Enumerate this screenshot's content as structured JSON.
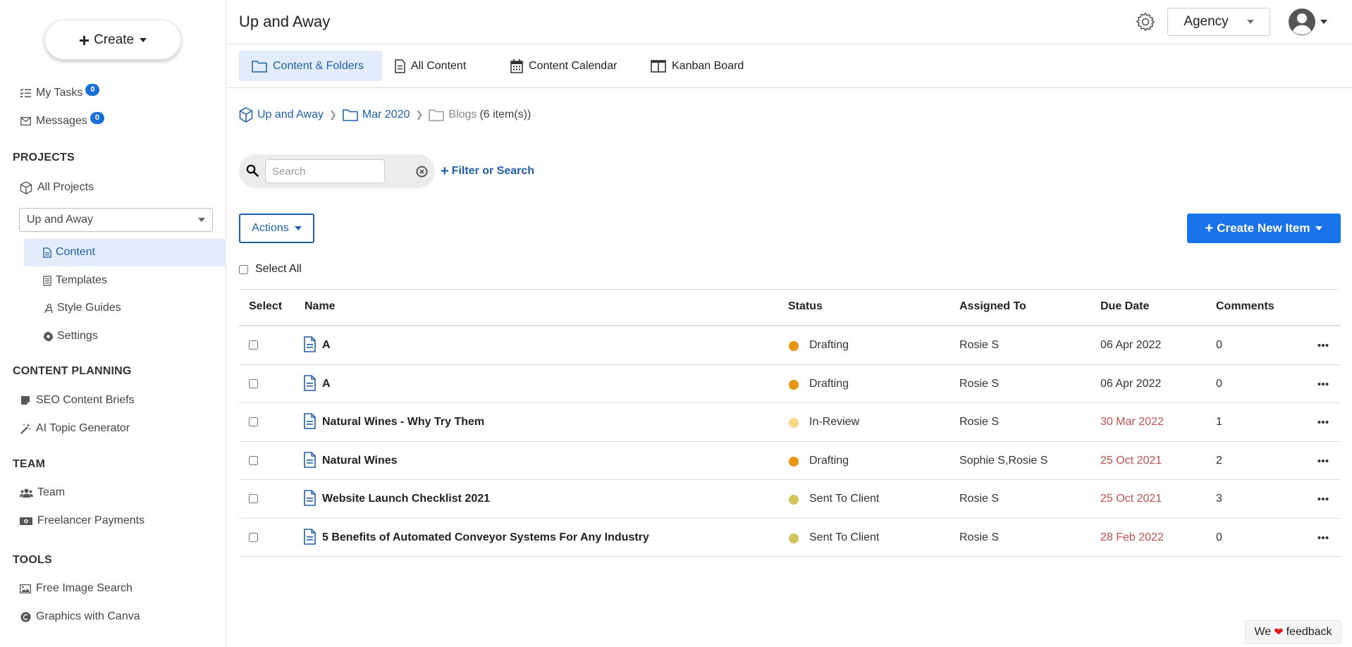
{
  "sidebar": {
    "create_label": "Create",
    "my_tasks": {
      "label": "My Tasks",
      "count": "0"
    },
    "messages": {
      "label": "Messages",
      "count": "0"
    },
    "projects_heading": "PROJECTS",
    "all_projects": "All Projects",
    "project_selected": "Up and Away",
    "project_items": [
      "Content",
      "Templates",
      "Style Guides",
      "Settings"
    ],
    "content_planning_heading": "CONTENT PLANNING",
    "content_planning_items": [
      "SEO Content Briefs",
      "AI Topic Generator"
    ],
    "team_heading": "TEAM",
    "team_items": [
      "Team",
      "Freelancer Payments"
    ],
    "tools_heading": "TOOLS",
    "tools_items": [
      "Free Image Search",
      "Graphics with Canva"
    ]
  },
  "header": {
    "title": "Up and Away",
    "org_selector": "Agency"
  },
  "tabs": [
    "Content & Folders",
    "All Content",
    "Content Calendar",
    "Kanban Board"
  ],
  "breadcrumb": {
    "project": "Up and Away",
    "folder": "Mar 2020",
    "current": "Blogs",
    "count": "(6 item(s))"
  },
  "search": {
    "placeholder": "Search",
    "value": "",
    "filter_label": "Filter or Search"
  },
  "toolbar": {
    "actions_label": "Actions",
    "create_new_label": "Create New Item",
    "select_all_label": "Select All"
  },
  "table": {
    "columns": [
      "Select",
      "Name",
      "Status",
      "Assigned To",
      "Due Date",
      "Comments"
    ],
    "rows": [
      {
        "name": "A",
        "status": "Drafting",
        "assigned": "Rosie S",
        "due": "06 Apr 2022",
        "comments": "0"
      },
      {
        "name": "A",
        "status": "Drafting",
        "assigned": "Rosie S",
        "due": "06 Apr 2022",
        "comments": "0"
      },
      {
        "name": "Natural Wines - Why Try Them",
        "status": "In-Review",
        "assigned": "Rosie S",
        "due": "30 Mar 2022",
        "comments": "1"
      },
      {
        "name": "Natural Wines",
        "status": "Drafting",
        "assigned": "Sophie S,Rosie S",
        "due": "25 Oct 2021",
        "comments": "2"
      },
      {
        "name": "Website Launch Checklist 2021",
        "status": "Sent To Client",
        "assigned": "Rosie S",
        "due": "25 Oct 2021",
        "comments": "3"
      },
      {
        "name": "5 Benefits of Automated Conveyor Systems For Any Industry",
        "status": "Sent To Client",
        "assigned": "Rosie S",
        "due": "28 Feb 2022",
        "comments": "0"
      }
    ]
  },
  "status_colors": {
    "Drafting": "#e8950f",
    "In-Review": "#f6d586",
    "Sent To Client": "#cfc55a"
  },
  "due_colors": {
    "normal": "#333333",
    "overdue": "#c0504d"
  },
  "accent_color": "#1a73e8",
  "feedback": {
    "prefix": "We",
    "suffix": "feedback"
  }
}
